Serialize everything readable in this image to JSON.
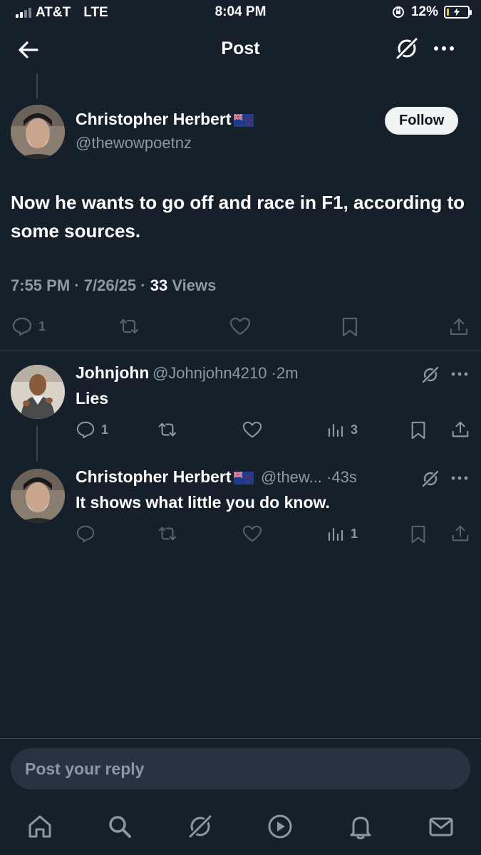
{
  "status_bar": {
    "carrier": "AT&T",
    "network": "LTE",
    "time": "8:04 PM",
    "battery": "12%",
    "battery_level": 0.12
  },
  "header": {
    "title": "Post",
    "back_icon": "arrow-left-icon",
    "grok_icon": "grok-icon",
    "more_icon": "more-icon"
  },
  "main_post": {
    "author_name": "Christopher Herbert",
    "flag": "new-zealand-flag-icon",
    "handle": "@thewowpoetnz",
    "follow_label": "Follow",
    "text": "Now he wants to go off and race in F1, according to some sources.",
    "time": "7:55 PM",
    "date": "7/26/25",
    "views_count": "33",
    "views_label": "Views",
    "actions": {
      "replies": "1"
    }
  },
  "replies": [
    {
      "author_name": "Johnjohn",
      "handle": "@Johnjohn4210",
      "age": "2m",
      "text": "Lies",
      "reply_count": "1",
      "views": "3"
    },
    {
      "author_name": "Christopher Herbert",
      "handle": "@thew...",
      "age": "43s",
      "text": "It shows what little you do know.",
      "views": "1"
    }
  ],
  "reply_input": {
    "placeholder": "Post your reply"
  },
  "bottom_nav": [
    "home-icon",
    "search-icon",
    "grok-icon",
    "video-icon",
    "notifications-icon",
    "messages-icon"
  ],
  "colors": {
    "background": "#15202b",
    "secondary_text": "#8b98a5",
    "divider": "#38444d",
    "reply_bar": "#273340"
  }
}
